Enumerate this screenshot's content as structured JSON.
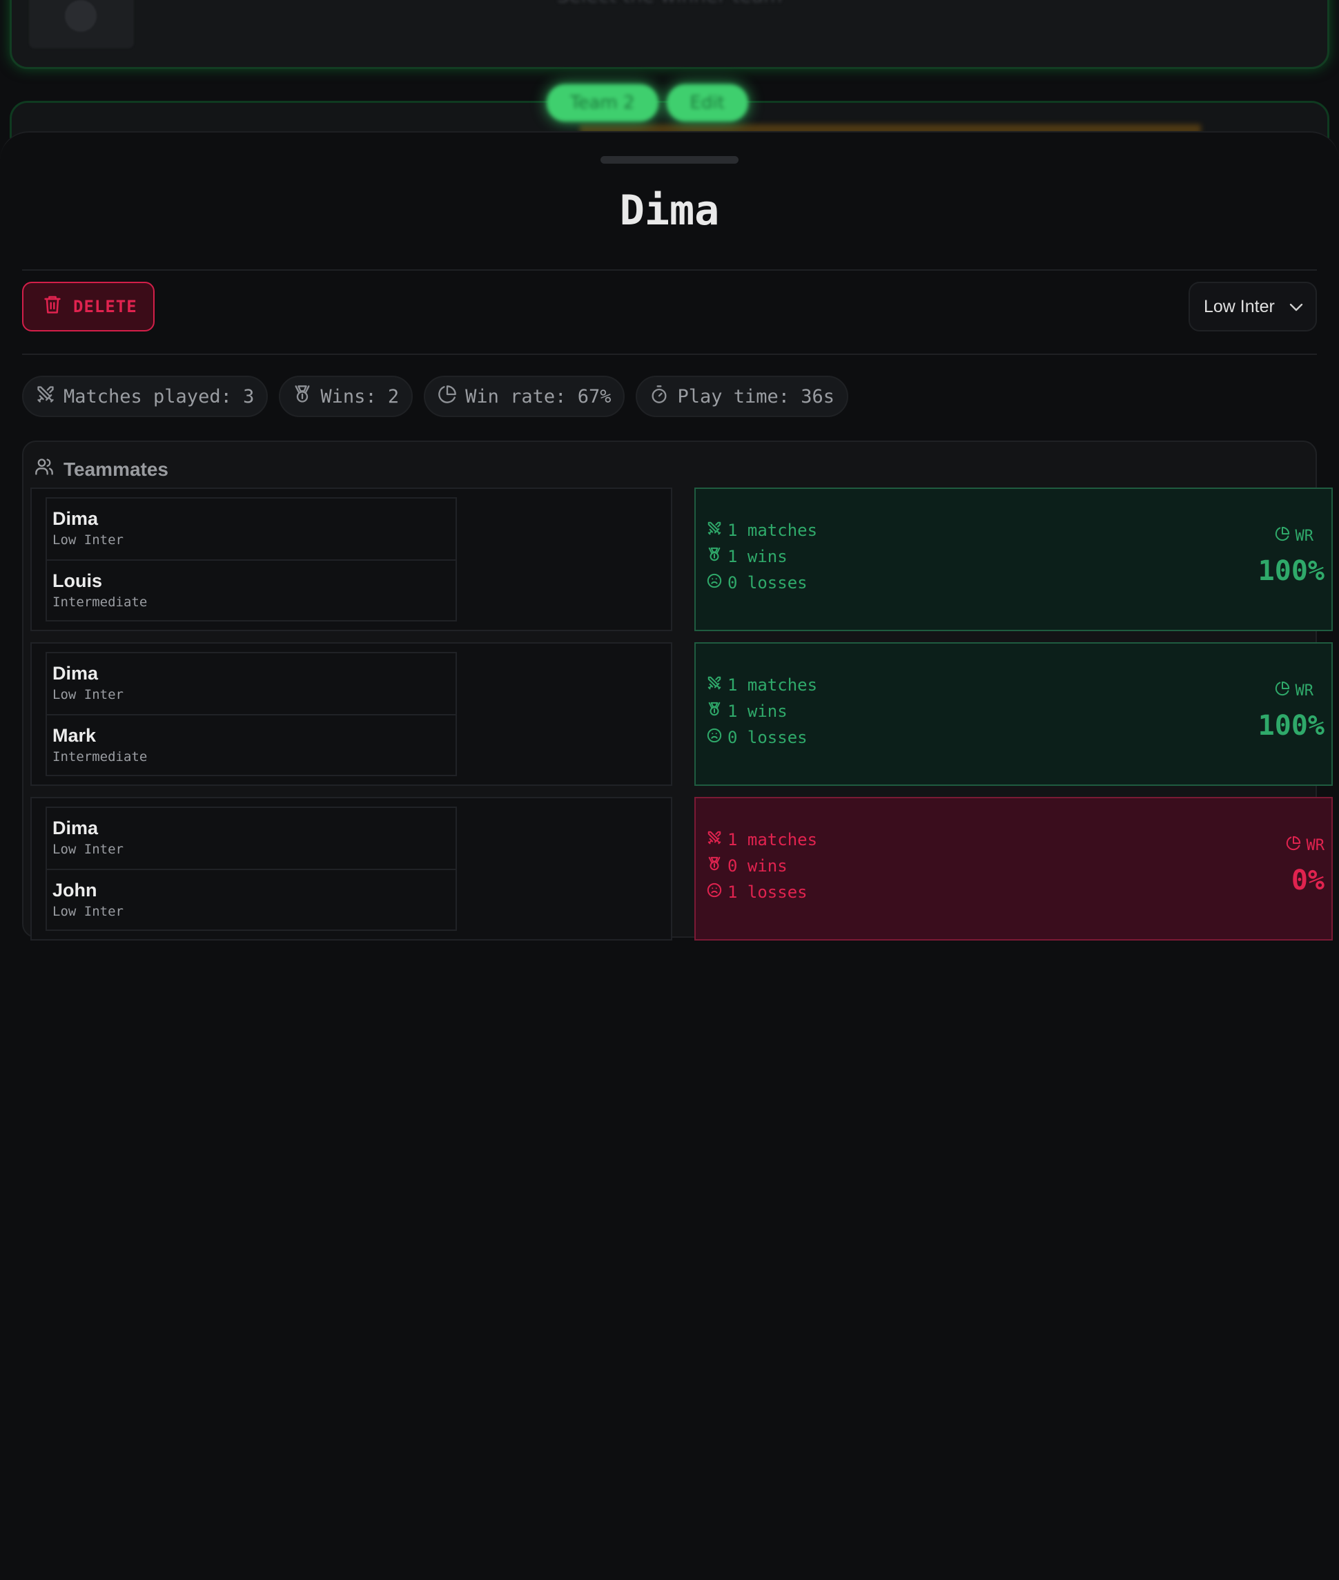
{
  "backdrop": {
    "card_text": "Select the winner team",
    "pills": [
      "Team 2",
      "Edit"
    ]
  },
  "sheet": {
    "title": "Dima",
    "delete_label": "DELETE",
    "level_select": {
      "value": "Low Inter"
    }
  },
  "stats": {
    "matches": "Matches played: 3",
    "wins": "Wins: 2",
    "winrate": "Win rate: 67%",
    "playtime": "Play time: 36s"
  },
  "teammates": {
    "title": "Teammates",
    "rows": [
      {
        "result": "win",
        "players": [
          {
            "name": "Dima",
            "level": "Low Inter"
          },
          {
            "name": "Louis",
            "level": "Intermediate"
          }
        ],
        "matches": "1 matches",
        "wins": "1 wins",
        "losses": "0 losses",
        "wr_label": "WR",
        "wr_value": "100%"
      },
      {
        "result": "win",
        "players": [
          {
            "name": "Dima",
            "level": "Low Inter"
          },
          {
            "name": "Mark",
            "level": "Intermediate"
          }
        ],
        "matches": "1 matches",
        "wins": "1 wins",
        "losses": "0 losses",
        "wr_label": "WR",
        "wr_value": "100%"
      },
      {
        "result": "loss",
        "players": [
          {
            "name": "Dima",
            "level": "Low Inter"
          },
          {
            "name": "John",
            "level": "Low Inter"
          }
        ],
        "matches": "1 matches",
        "wins": "0 wins",
        "losses": "1 losses",
        "wr_label": "WR",
        "wr_value": "0%"
      }
    ]
  },
  "colors": {
    "win": "#2fa96a",
    "loss": "#e0234f",
    "accent_green": "#3fcf6e",
    "background": "#0d0e10"
  },
  "icons": {
    "matches": "swords-icon",
    "wins": "medal-icon",
    "winrate": "pie-chart-icon",
    "playtime": "timer-icon",
    "losses": "frown-icon",
    "delete": "trash-icon",
    "select": "chevron-down-icon",
    "teammates": "users-icon"
  }
}
